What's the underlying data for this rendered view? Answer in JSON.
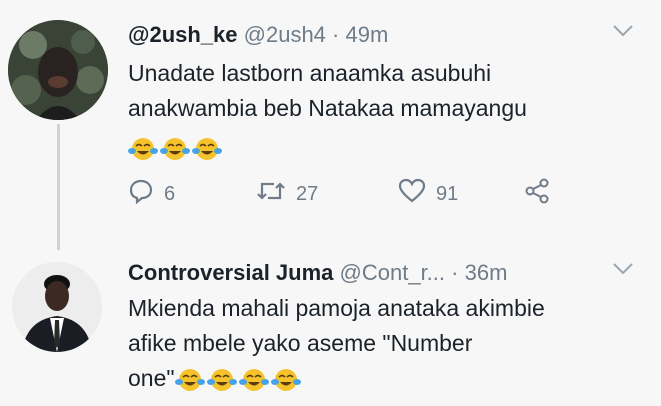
{
  "tweets": [
    {
      "display_name": "@2ush_ke",
      "handle": "@2ush4",
      "separator": "·",
      "time": "49m",
      "text_line1": "Unadate lastborn anaamka asubuhi",
      "text_line2": "anakwambia beb Natakaa mamayangu",
      "emoji_count": 3,
      "replies": "6",
      "retweets": "27",
      "likes": "91"
    },
    {
      "display_name": "Controversial Juma",
      "handle": "@Cont_r...",
      "separator": "·",
      "time": "36m",
      "text_line1": "Mkienda mahali pamoja anataka akimbie",
      "text_line2": "afike mbele yako aseme \"Number",
      "text_line3": "one\"",
      "emoji_count": 4
    }
  ],
  "icons": {
    "reply": "reply-icon",
    "retweet": "retweet-icon",
    "like": "heart-icon",
    "share": "share-icon",
    "caret": "chevron-down-icon",
    "emoji": "face-with-tears-of-joy"
  },
  "colors": {
    "background": "#f7f7f7",
    "text": "#1c2229",
    "muted": "#6f7c88",
    "thread_line": "#cdd3da",
    "emoji": "#f4c22b"
  }
}
